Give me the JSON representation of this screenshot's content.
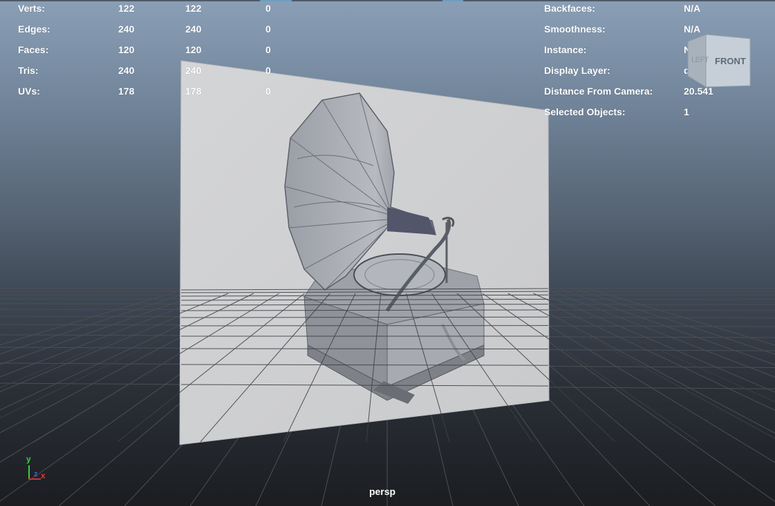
{
  "viewport": {
    "camera": "persp",
    "colors": {
      "sky_top": "#8a9fb6",
      "horizon": "#3e4855",
      "bottom": "#1b1d21",
      "text": "#ffffff"
    }
  },
  "stats_left": [
    {
      "label": "Verts:",
      "v1": "122",
      "v2": "122",
      "v3": "0"
    },
    {
      "label": "Edges:",
      "v1": "240",
      "v2": "240",
      "v3": "0"
    },
    {
      "label": "Faces:",
      "v1": "120",
      "v2": "120",
      "v3": "0"
    },
    {
      "label": "Tris:",
      "v1": "240",
      "v2": "240",
      "v3": "0"
    },
    {
      "label": "UVs:",
      "v1": "178",
      "v2": "178",
      "v3": "0"
    }
  ],
  "stats_right": [
    {
      "label": "Backfaces:",
      "value": "N/A"
    },
    {
      "label": "Smoothness:",
      "value": "N/A"
    },
    {
      "label": "Instance:",
      "value": "No"
    },
    {
      "label": "Display Layer:",
      "value": "default"
    },
    {
      "label": "Distance From Camera:",
      "value": "20.541"
    },
    {
      "label": "Selected Objects:",
      "value": "1"
    }
  ],
  "viewcube": {
    "left_face": "LEFT",
    "front_face": "FRONT"
  },
  "axis": {
    "y": "y",
    "z": "z",
    "x": "x"
  },
  "icons": [
    "viewcube-icon",
    "axis-gizmo-icon"
  ]
}
